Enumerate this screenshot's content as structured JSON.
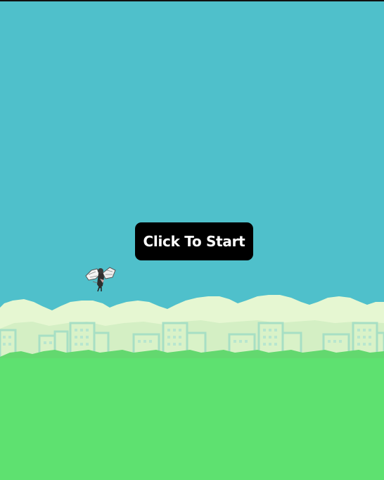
{
  "game": {
    "start_button_label": "Click To Start"
  },
  "sprites": {
    "player": "winged-fairy-sprite",
    "background": "city-skyline-with-clouds"
  },
  "colors": {
    "sky": "#4fc0cb",
    "cloud": "#e6f7d2",
    "cloud_edge": "#d4efc4",
    "building": "#d9f2c8",
    "building_outline": "#a7dfc4",
    "building_window": "#b8e6cf",
    "bush": "#63d86f",
    "bush_line": "#53c865",
    "ground": "#5ee170",
    "button_bg": "#000000",
    "button_text": "#ffffff"
  }
}
